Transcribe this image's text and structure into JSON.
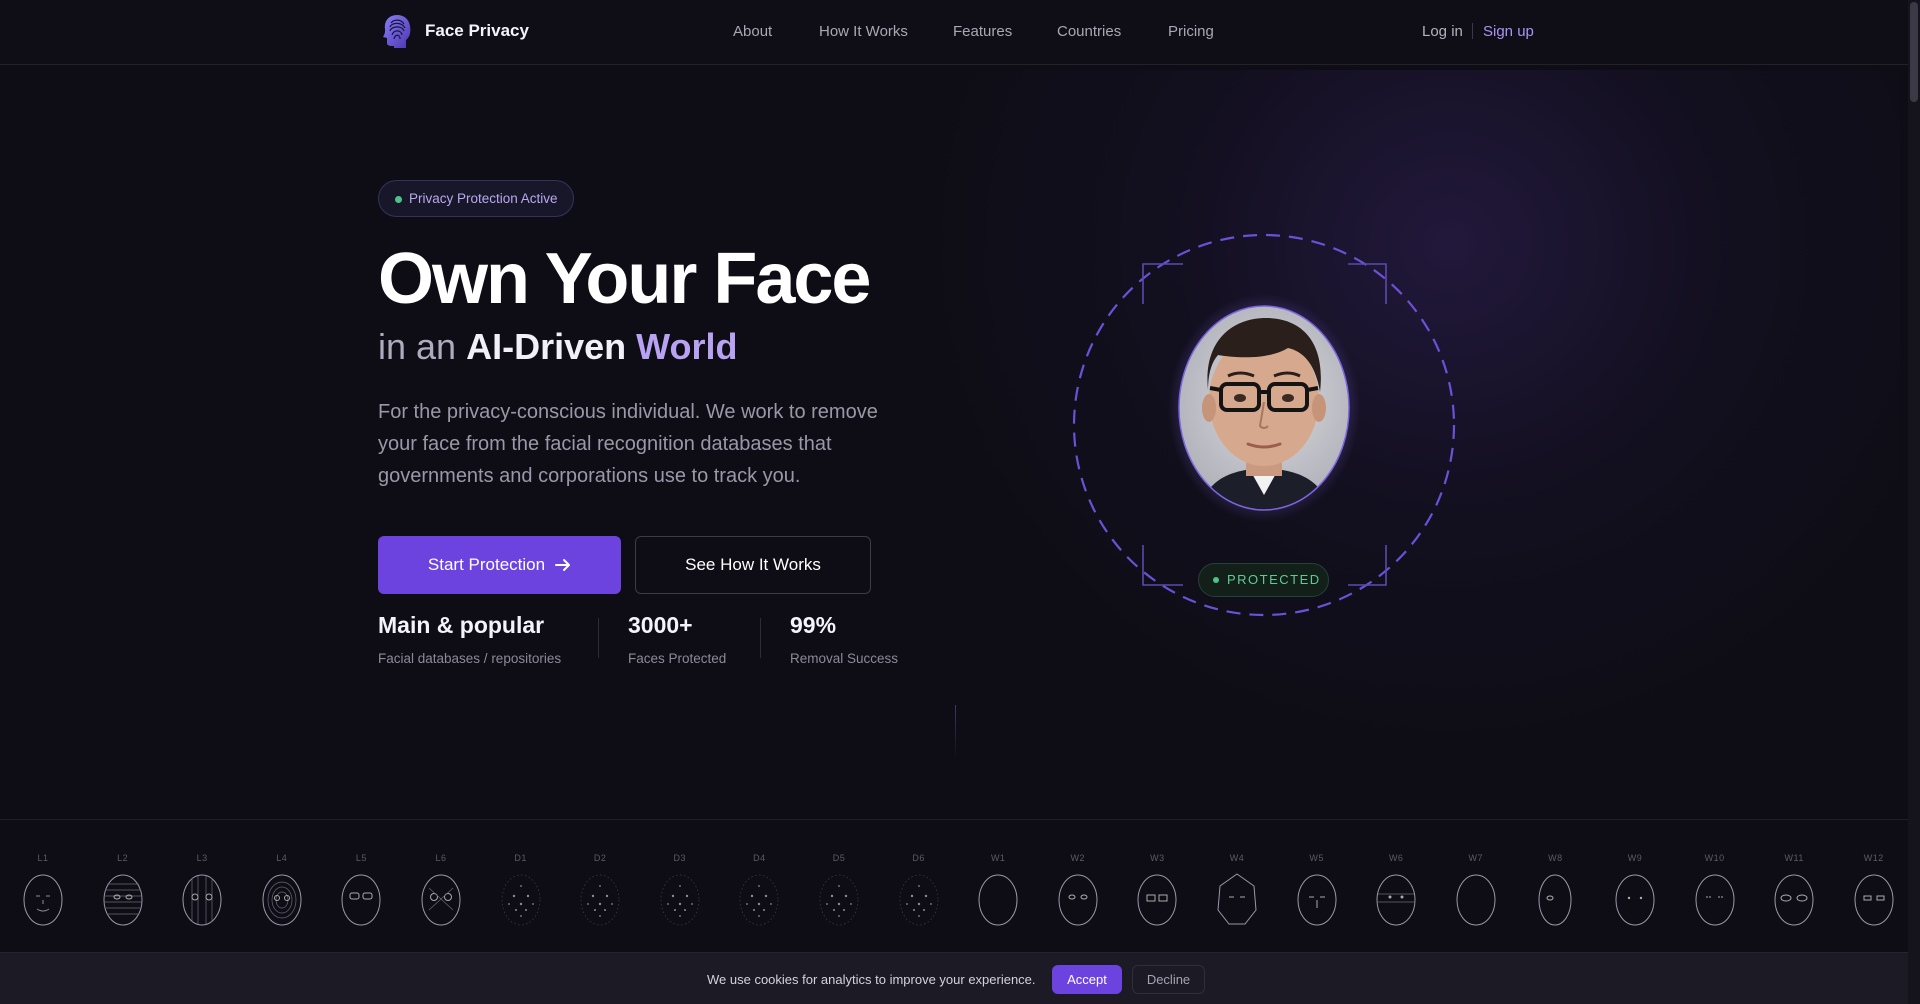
{
  "header": {
    "brand": "Face Privacy",
    "logo_icon": "fingerprint-head-icon",
    "nav": [
      "About",
      "How It Works",
      "Features",
      "Countries",
      "Pricing"
    ],
    "login": "Log in",
    "signup": "Sign up"
  },
  "hero": {
    "badge": "Privacy Protection Active",
    "title": "Own Your Face",
    "subtitle_a": "in an",
    "subtitle_b": "AI-Driven",
    "subtitle_c": "World",
    "description": "For the privacy-conscious individual. We work to remove your face from the facial recognition databases that governments and corporations use to track you.",
    "primary_button": "Start Protection",
    "primary_button_icon": "arrow-right-icon",
    "secondary_button": "See How It Works",
    "stats": [
      {
        "value": "Main & popular",
        "label": "Facial databases / repositories"
      },
      {
        "value": "3000+",
        "label": "Faces Protected"
      },
      {
        "value": "99%",
        "label": "Removal Success"
      }
    ]
  },
  "visual": {
    "protected_label": "PROTECTED",
    "face_image": "portrait-photo"
  },
  "face_strip": {
    "labels": [
      "L1",
      "L2",
      "L3",
      "L4",
      "L5",
      "L6",
      "D1",
      "D2",
      "D3",
      "D4",
      "D5",
      "D6",
      "W1",
      "W2",
      "W3",
      "W4",
      "W5",
      "W6",
      "W7",
      "W8",
      "W9",
      "W10",
      "W11",
      "W12"
    ]
  },
  "cookie": {
    "text": "We use cookies for analytics to improve your experience.",
    "accept": "Accept",
    "decline": "Decline"
  },
  "colors": {
    "background": "#0e0d15",
    "accent": "#6d43e0",
    "accent_light": "#b8a3f2",
    "success": "#4cc38a"
  }
}
